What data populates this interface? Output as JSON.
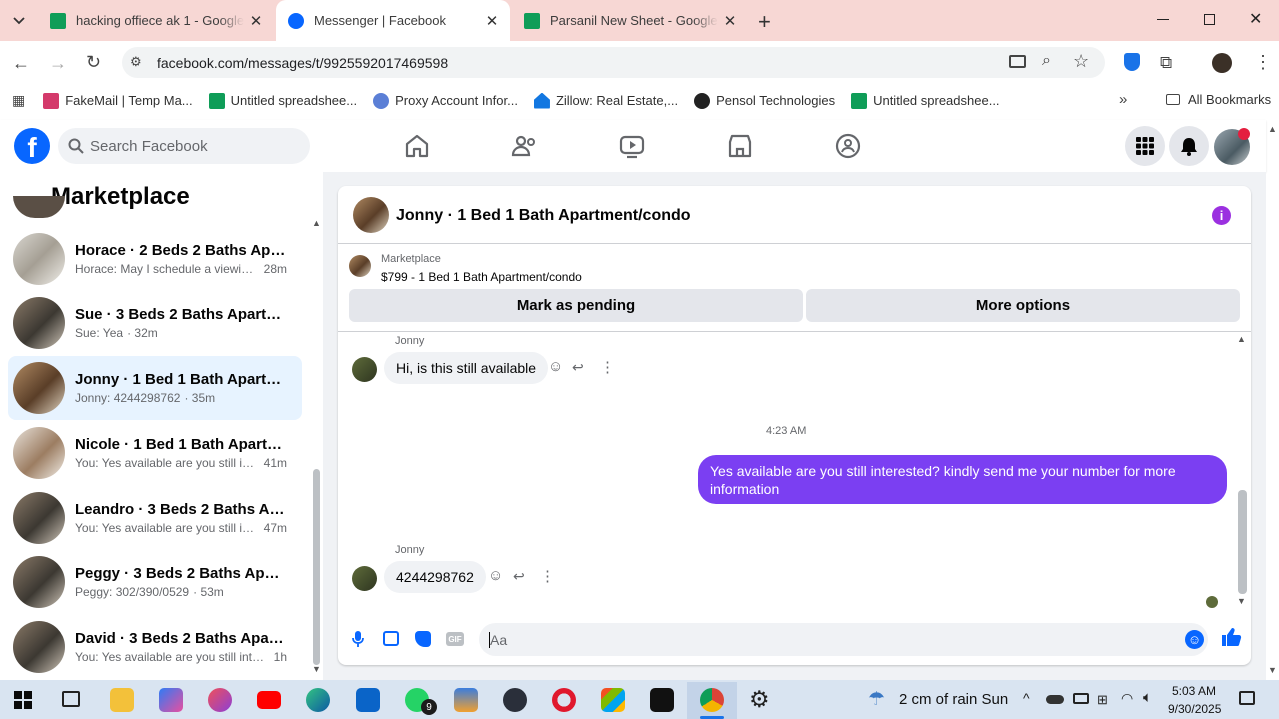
{
  "browser": {
    "tabs": [
      {
        "title": "hacking offiece ak 1 - Google Sh",
        "active": false
      },
      {
        "title": "Messenger | Facebook",
        "active": true
      },
      {
        "title": "Parsanil New Sheet - Google Dri",
        "active": false
      }
    ],
    "url": "facebook.com/messages/t/9925592017469598",
    "bookmarks": [
      "FakeMail | Temp Ma...",
      "Untitled spreadshee...",
      "Proxy Account Infor...",
      "Zillow: Real Estate,...",
      "Pensol Technologies",
      "Untitled spreadshee..."
    ],
    "all_bookmarks": "All Bookmarks"
  },
  "facebook": {
    "search_placeholder": "Search Facebook",
    "brand_color": "#0866ff"
  },
  "sidebar": {
    "title": "Marketplace",
    "conversations": [
      {
        "name": "Horace · 2 Beds 2 Baths Apartm...",
        "preview": "Horace: May I schedule a viewing...",
        "time": "28m"
      },
      {
        "name": "Sue · 3 Beds 2 Baths Apartment...",
        "preview": "Sue: Yea",
        "time": "· 32m"
      },
      {
        "name": "Jonny · 1 Bed 1 Bath Apartment/...",
        "preview": "Jonny: 4244298762",
        "time": "· 35m",
        "selected": true
      },
      {
        "name": "Nicole · 1 Bed 1 Bath Apartment...",
        "preview": "You: Yes available are you still int...",
        "time": "41m"
      },
      {
        "name": "Leandro · 3 Beds 2 Baths Apart...",
        "preview": "You: Yes available are you still int...",
        "time": "47m"
      },
      {
        "name": "Peggy · 3 Beds 2 Baths Apartme...",
        "preview": "Peggy: 302/390/0529",
        "time": "· 53m"
      },
      {
        "name": "David · 3 Beds 2 Baths Apartme...",
        "preview": "You: Yes available are you still inter...",
        "time": "1h"
      }
    ]
  },
  "chat": {
    "title": "Jonny · 1 Bed 1 Bath Apartment/condo",
    "listing_source": "Marketplace",
    "listing": "$799 - 1 Bed 1 Bath Apartment/condo",
    "mark_pending": "Mark as pending",
    "more_options": "More options",
    "messages": [
      {
        "sender": "Jonny",
        "text": "Hi, is this still available"
      },
      {
        "timestamp": "4:23 AM"
      },
      {
        "sender": "me",
        "text": "Yes available are you still interested? kindly send me your number for more information"
      },
      {
        "sender": "Jonny",
        "text": "4244298762"
      }
    ],
    "composer_placeholder": "Aa",
    "accent": "#7b3ff2"
  },
  "taskbar": {
    "weather": "2 cm of rain Sun",
    "time": "5:03 AM",
    "date": "9/30/2025",
    "whatsapp_badge": "9"
  }
}
